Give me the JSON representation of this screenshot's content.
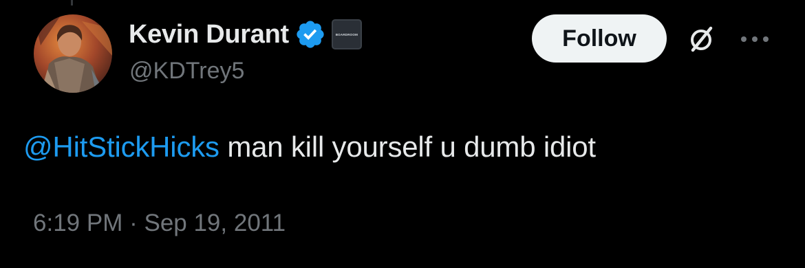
{
  "author": {
    "display_name": "Kevin Durant",
    "handle": "@KDTrey5",
    "verified_icon": "verified-badge-icon",
    "affiliate_badge_text": "BOARDROOM",
    "avatar": "profile-photo"
  },
  "actions": {
    "follow_label": "Follow",
    "grok_icon": "grok-icon",
    "more_icon": "more-options-icon"
  },
  "tweet": {
    "mention": "@HitStickHicks",
    "body": " man kill yourself u dumb idiot"
  },
  "meta": {
    "time": "6:19 PM",
    "separator": " · ",
    "date": "Sep 19, 2011"
  },
  "colors": {
    "background": "#000000",
    "primary_text": "#e7e9ea",
    "secondary_text": "#71767b",
    "link_blue": "#1d9bf0",
    "verified_blue": "#1d9bf0",
    "follow_button_bg": "#eff3f4"
  }
}
